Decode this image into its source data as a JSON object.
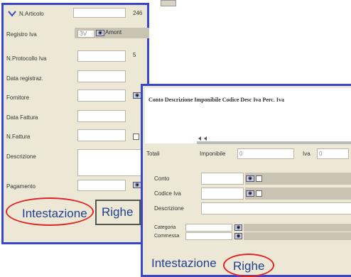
{
  "form1": {
    "n_articolo_label": "N.Articolo",
    "n_articolo_count": "246",
    "registro_label": "Registro Iva",
    "registro_value": "ЗV",
    "registro_name": "Amont",
    "protocollo_label": "N.Protocollo Iva",
    "protocollo_value": "5",
    "data_registraz_label": "Data registraz.",
    "fornitore_label": "Fornitore",
    "data_fattura_label": "Data Fattura",
    "n_fattura_label": "N.Fattura",
    "descrizione_label": "Descrizione",
    "pagamento_label": "Pagamento",
    "tab_intestazione": "Intestazione",
    "tab_righe": "Righe"
  },
  "form2": {
    "grid_headers": "Conto Descrizione Imponibile Codice Desc Iva Perc. Iva",
    "totali_label": "Totali",
    "imponibile_label": "Imponibile",
    "imponibile_value": "0",
    "iva_label": "Iva",
    "iva_value": "0",
    "conto_label": "Conto",
    "codice_iva_label": "Codice Iva",
    "descrizione_label": "Descrizione",
    "categoria_label": "Categoria",
    "commessa_label": "Commessa",
    "tab_intestazione": "Intestazione",
    "tab_righe": "Righe"
  },
  "icons": {
    "binoculars": "binoculars-icon",
    "nav": "nav-arrows-icon",
    "checkbox": "checkbox"
  },
  "colors": {
    "window_border": "#3a46c9",
    "panel_bg": "#ede8d6",
    "highlight_oval": "#e02424",
    "tab_text": "#1f3f8f"
  }
}
